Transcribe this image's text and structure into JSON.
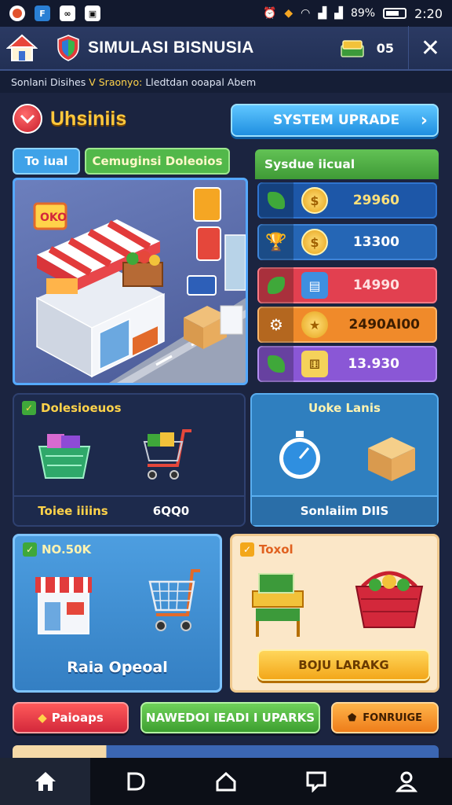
{
  "statusbar": {
    "battery": "89%",
    "time": "2:20"
  },
  "header": {
    "title": "SIMULASI BISNUSIA",
    "coins": "05"
  },
  "subbar": {
    "left": "Sonlani Disihes",
    "highlight": "V Sraonyo:",
    "right": "Lledtdan ooapal Abem"
  },
  "section": {
    "title": "Uhsiniis",
    "upgrade_button": "SYSTEM UPRADE"
  },
  "tabs": [
    {
      "label": "To iual"
    },
    {
      "label": "Cemuginsi Doleoios"
    }
  ],
  "stats": {
    "title": "Sysdue iicual",
    "rows": [
      {
        "value": "29960",
        "color": "#1d57a8"
      },
      {
        "value": "13300",
        "color": "#2566b5"
      },
      {
        "value": "14990",
        "color": "#e24050"
      },
      {
        "value": "2490AI00",
        "color": "#f08a2a"
      },
      {
        "value": "13.930",
        "color": "#8a57d6"
      }
    ]
  },
  "panel_left": {
    "title": "Dolesioeuos",
    "footer_a": "Toiee iiiins",
    "footer_b": "6QQ0"
  },
  "panel_right": {
    "title": "Uoke Lanis",
    "footer": "Sonlaiim DIIS"
  },
  "panel_blue": {
    "title": "NO.50K",
    "label": "Raia Opeoal"
  },
  "panel_cream": {
    "title": "Toxol",
    "button": "BOJU LARAKG"
  },
  "actions": {
    "red": "Paioaps",
    "green": "NAWEDOI IEADI I UPARKS",
    "orange": "FONRUIGE"
  },
  "colors": {
    "accent_gold": "#ffc83d",
    "accent_blue": "#1f8fe0",
    "background": "#1b2440"
  }
}
